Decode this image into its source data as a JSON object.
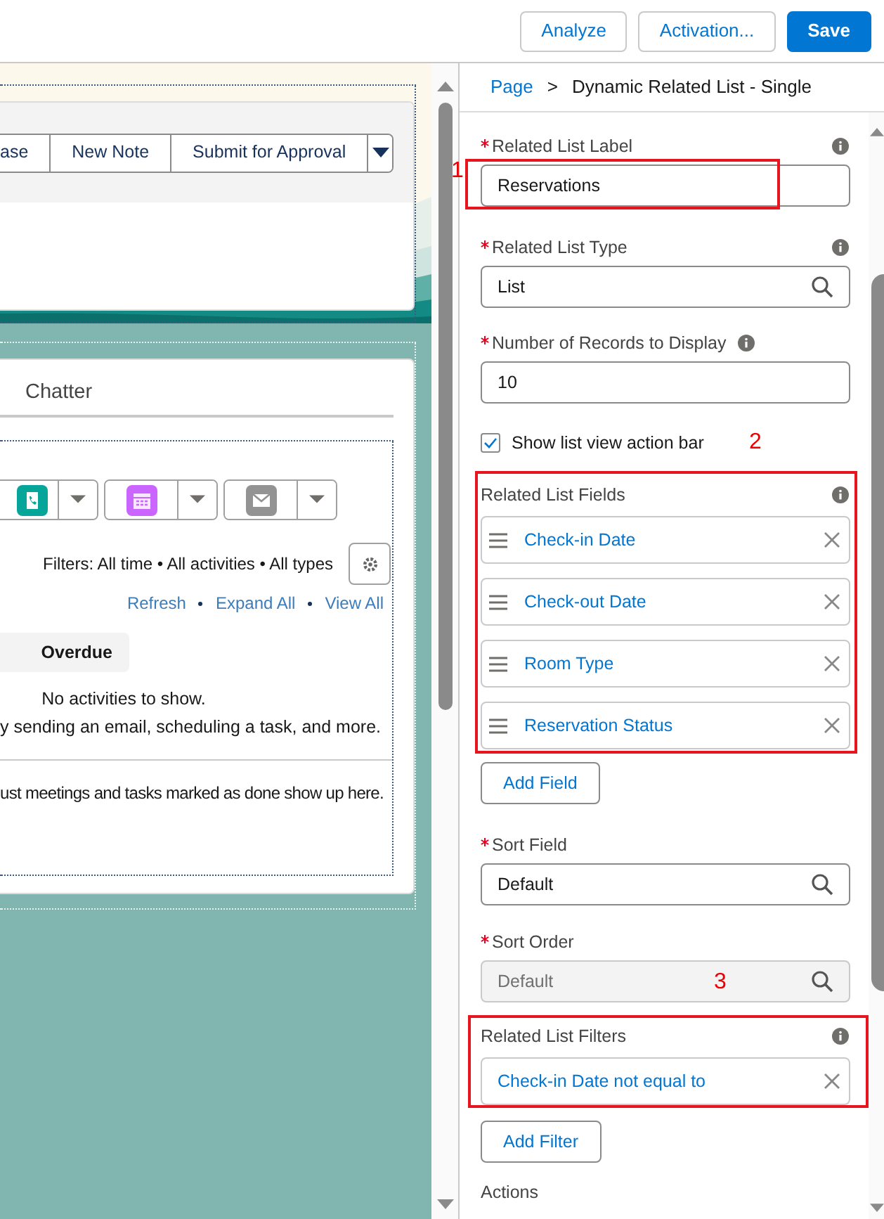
{
  "toolbar": {
    "buttons": [
      {
        "label": "Analyze",
        "kind": "outline"
      },
      {
        "label": "Activation...",
        "kind": "outline"
      },
      {
        "label": "Save",
        "kind": "brand"
      }
    ]
  },
  "canvas": {
    "header_actions": [
      {
        "label": "ase"
      },
      {
        "label": "New Note"
      },
      {
        "label": "Submit for Approval"
      }
    ],
    "tabs": [
      {
        "label": "Chatter",
        "selected": false
      }
    ],
    "composer_buttons": [
      {
        "color": "#06a59a"
      },
      {
        "color": "#cb65ff"
      },
      {
        "color": "#939393"
      }
    ],
    "filters": "Filters: All time • All activities • All types",
    "links": [
      "Refresh",
      "Expand All",
      "View All"
    ],
    "section": "Overdue",
    "empty_message": "No activities to show.",
    "empty_hint": "y sending an email, scheduling a task, and more.",
    "past_hint": "ust meetings and tasks marked as done show up here."
  },
  "properties": {
    "breadcrumb": [
      {
        "label": "Page",
        "kind": "link"
      },
      {
        "label": ">",
        "kind": "separator"
      },
      {
        "label": "Dynamic Related List - Single",
        "kind": "current"
      }
    ],
    "form": [
      {
        "kind": "text_field",
        "label": "Related List Label",
        "required": true,
        "info": true,
        "value": "Reservations",
        "annotation": "1"
      },
      {
        "kind": "lookup",
        "label": "Related List Type",
        "required": true,
        "info": true,
        "value": "List"
      },
      {
        "kind": "text_field",
        "label": "Number of Records to Display",
        "required": true,
        "info": true,
        "value": "10"
      },
      {
        "kind": "checkbox",
        "label": "Show list view action bar",
        "checked": true,
        "annotation": "2"
      },
      {
        "kind": "list",
        "label": "Related List Fields",
        "info": true,
        "items": [
          "Check-in Date",
          "Check-out Date",
          "Room Type",
          "Reservation Status"
        ],
        "button": "Add Field"
      },
      {
        "kind": "lookup",
        "label": "Sort Field",
        "required": true,
        "value": "Default"
      },
      {
        "kind": "lookup",
        "label": "Sort Order",
        "required": true,
        "value": "Default",
        "disabled": true,
        "annotation": "3"
      },
      {
        "kind": "list",
        "label": "Related List Filters",
        "info": true,
        "items": [
          "Check-in Date not equal to"
        ],
        "button": "Add Filter"
      },
      {
        "kind": "heading",
        "label": "Actions"
      }
    ]
  }
}
